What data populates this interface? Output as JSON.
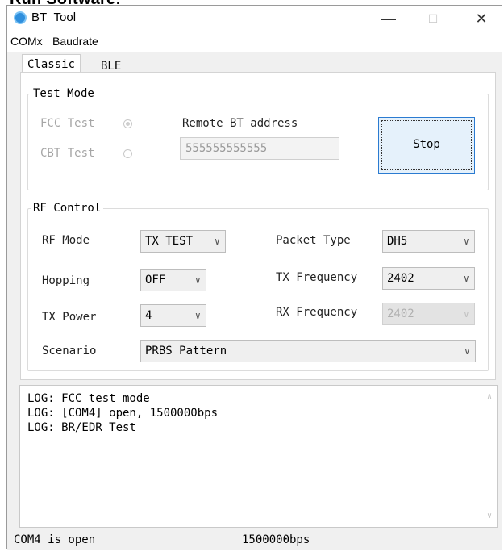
{
  "page_heading": "Run Software:",
  "window": {
    "title": "BT_Tool",
    "controls": {
      "minimize": "—",
      "maximize": "☐",
      "close": "✕"
    }
  },
  "menu": {
    "items": [
      "COMx",
      "Baudrate"
    ]
  },
  "tabs": [
    {
      "label": "Classic",
      "active": true
    },
    {
      "label": "BLE",
      "active": false
    }
  ],
  "test_mode": {
    "legend": "Test Mode",
    "fcc_test_label": "FCC Test",
    "fcc_test_checked": true,
    "cbt_test_label": "CBT Test",
    "cbt_test_checked": false,
    "remote_address_label": "Remote BT address",
    "remote_address_value": "555555555555",
    "stop_button_label": "Stop"
  },
  "rf_control": {
    "legend": "RF Control",
    "rf_mode_label": "RF Mode",
    "rf_mode_value": "TX TEST",
    "hopping_label": "Hopping",
    "hopping_value": "OFF",
    "tx_power_label": "TX Power",
    "tx_power_value": "4",
    "scenario_label": "Scenario",
    "scenario_value": "PRBS Pattern",
    "packet_type_label": "Packet Type",
    "packet_type_value": "DH5",
    "tx_frequency_label": "TX Frequency",
    "tx_frequency_value": "2402",
    "rx_frequency_label": "RX Frequency",
    "rx_frequency_value": "2402"
  },
  "log": {
    "lines": [
      "LOG: FCC test mode",
      "LOG: [COM4] open, 1500000bps",
      "LOG: BR/EDR Test"
    ]
  },
  "status": {
    "port": "COM4 is open",
    "baud": "1500000bps"
  }
}
